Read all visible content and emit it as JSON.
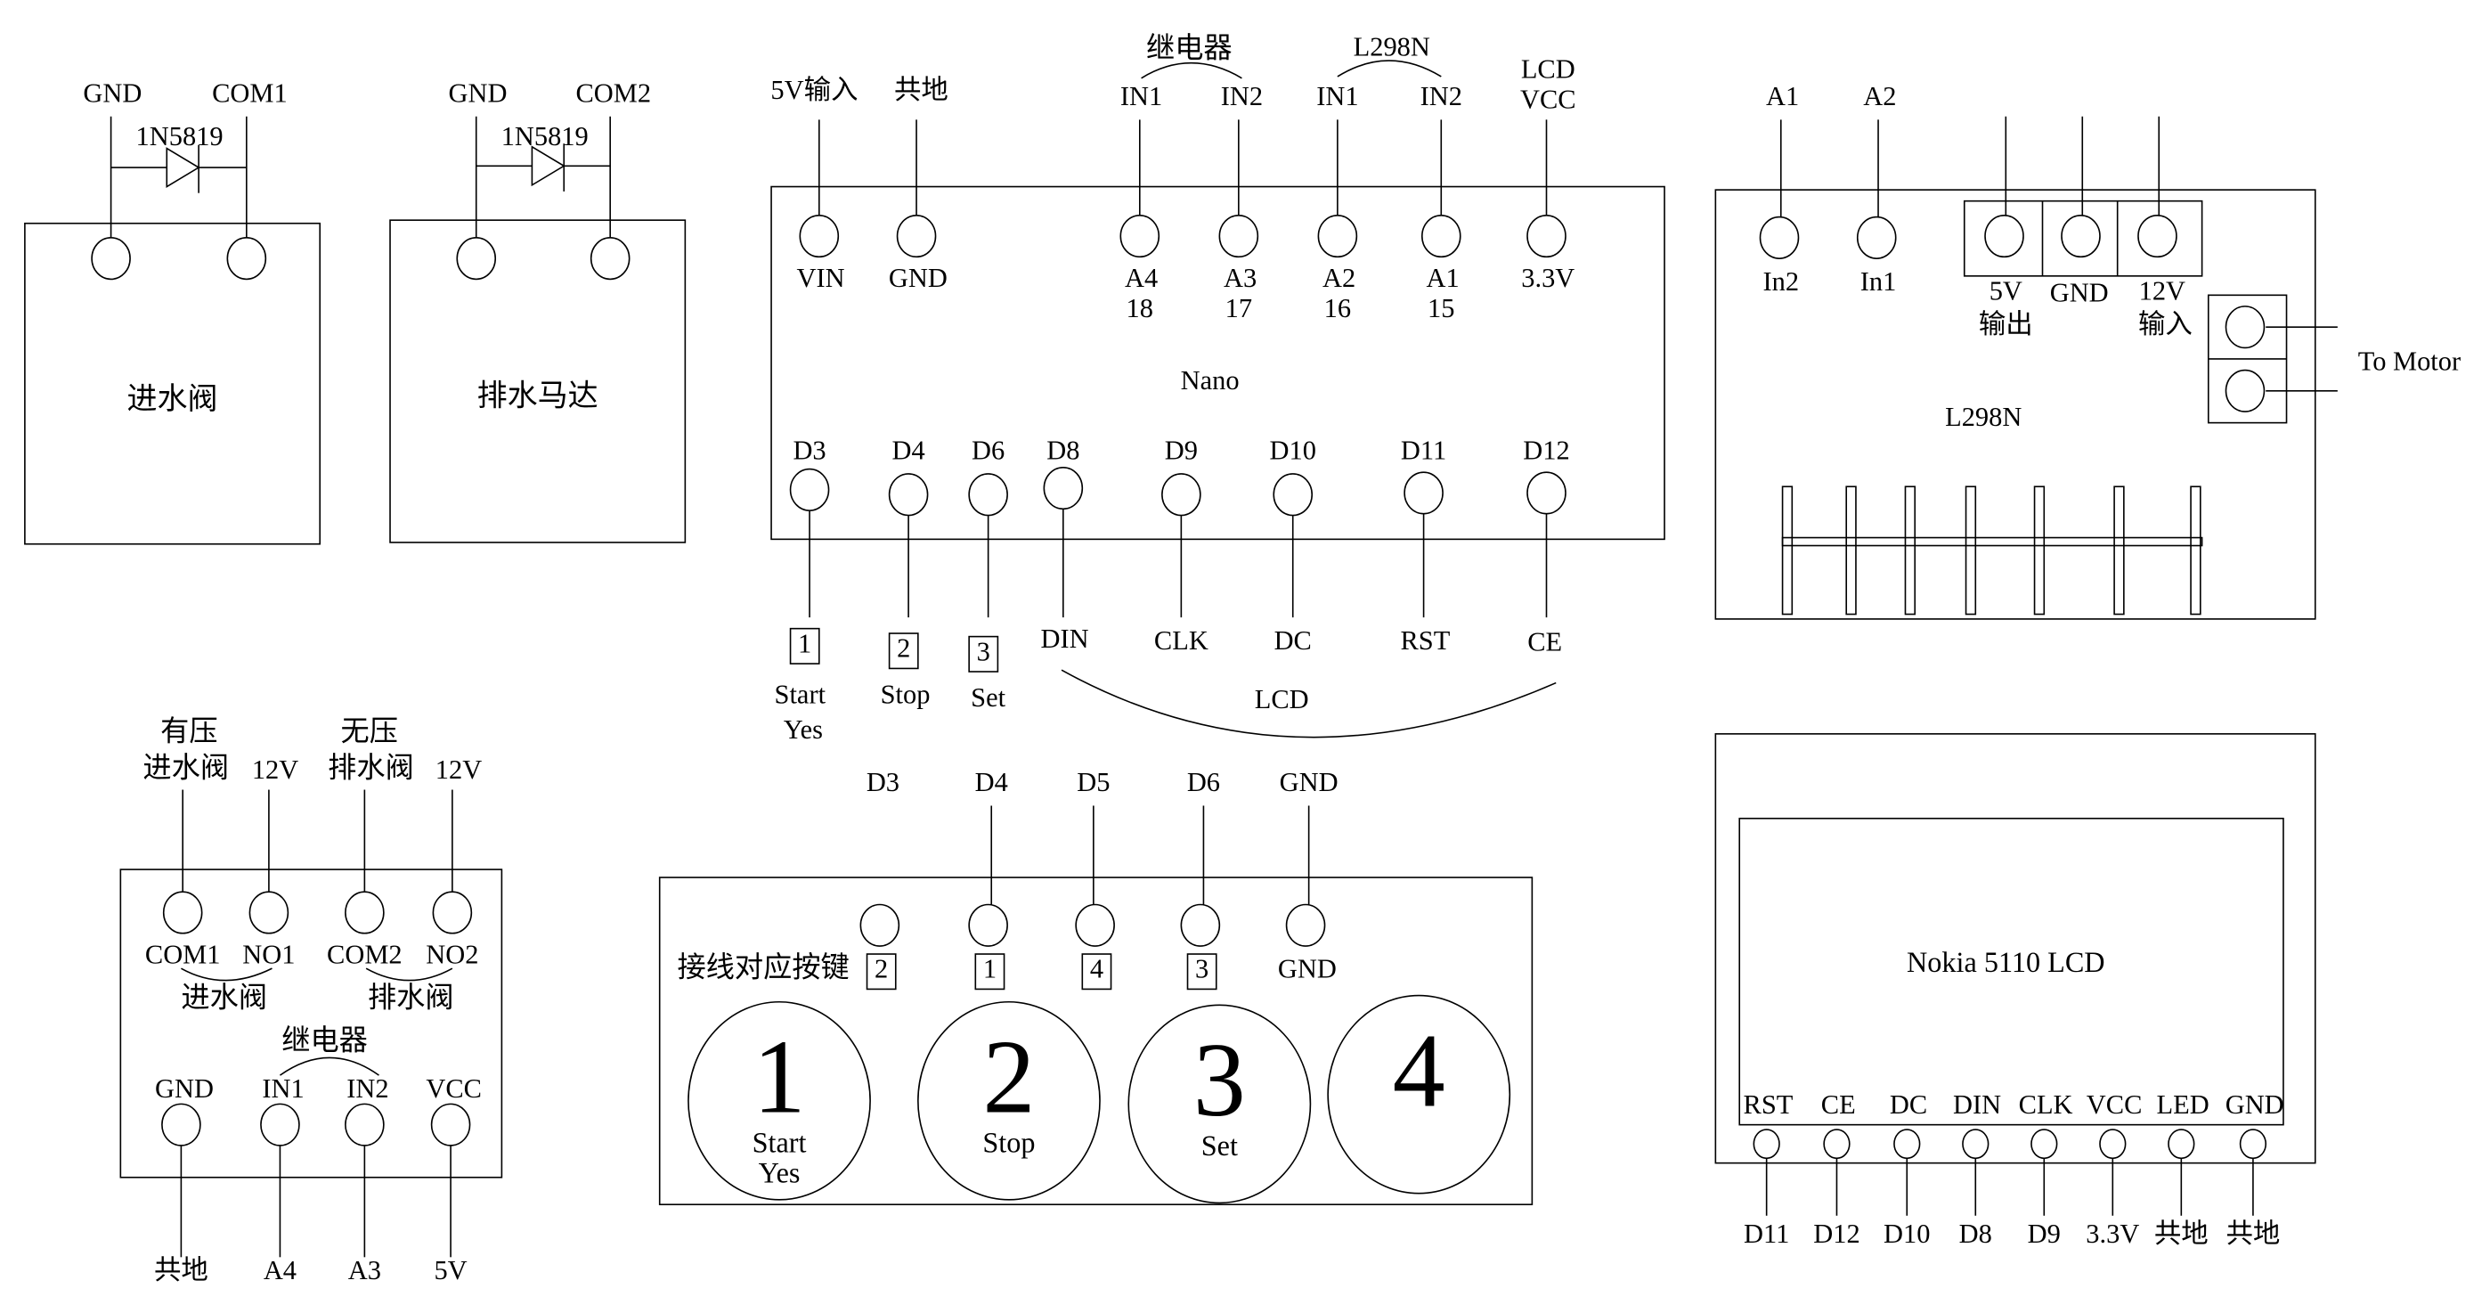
{
  "colors": {
    "line": "#000000",
    "background": "#ffffff"
  },
  "inlet_valve": {
    "title": "进水阀",
    "pins": [
      "GND",
      "COM1"
    ],
    "diode": "1N5819"
  },
  "drain_motor": {
    "title": "排水马达",
    "pins": [
      "GND",
      "COM2"
    ],
    "diode": "1N5819"
  },
  "nano": {
    "title": "Nano",
    "top_wires": {
      "vin": "5V输入",
      "gnd": "共地",
      "relay": "继电器",
      "relay_in1": "IN1",
      "relay_in2": "IN2",
      "l298n": "L298N",
      "l298n_in1": "IN1",
      "l298n_in2": "IN2",
      "lcd_vcc_1": "LCD",
      "lcd_vcc_2": "VCC"
    },
    "top_pins": [
      {
        "name": "VIN",
        "num": ""
      },
      {
        "name": "GND",
        "num": ""
      },
      {
        "name": "A4",
        "num": "18"
      },
      {
        "name": "A3",
        "num": "17"
      },
      {
        "name": "A2",
        "num": "16"
      },
      {
        "name": "A1",
        "num": "15"
      },
      {
        "name": "3.3V",
        "num": ""
      }
    ],
    "bottom_pins": [
      "D3",
      "D4",
      "D6",
      "D8",
      "D9",
      "D10",
      "D11",
      "D12"
    ],
    "bottom_targets": {
      "b1": "1",
      "b2": "2",
      "b3": "3",
      "din": "DIN",
      "clk": "CLK",
      "dc": "DC",
      "rst": "RST",
      "ce": "CE"
    },
    "button_names": {
      "start": "Start",
      "yes": "Yes",
      "stop": "Stop",
      "set": "Set"
    },
    "lcd_group": "LCD"
  },
  "l298n": {
    "title": "L298N",
    "wires": {
      "a1": "A1",
      "a2": "A2"
    },
    "pins": {
      "in2": "In2",
      "in1": "In1",
      "v5": "5V",
      "v5_sub": "输出",
      "gnd": "GND",
      "v12": "12V",
      "v12_sub": "输入"
    },
    "motor": "To Motor"
  },
  "relay": {
    "title": "继电器",
    "wires": {
      "pressured": "有压",
      "inlet_valve": "进水阀",
      "v12a": "12V",
      "unpressured": "无压",
      "drain_valve": "排水阀",
      "v12b": "12V"
    },
    "out_pins": [
      "COM1",
      "NO1",
      "COM2",
      "NO2"
    ],
    "out_groups": {
      "inlet": "进水阀",
      "drain": "排水阀"
    },
    "in_pins": [
      "GND",
      "IN1",
      "IN2",
      "VCC"
    ],
    "in_targets": [
      "共地",
      "A4",
      "A3",
      "5V"
    ]
  },
  "buttons": {
    "wires": [
      "D3",
      "D4",
      "D5",
      "D6",
      "GND"
    ],
    "map_label": "接线对应按键",
    "key_map": [
      "2",
      "1",
      "4",
      "3",
      "GND"
    ],
    "keys": [
      {
        "num": "1",
        "l1": "Start",
        "l2": "Yes"
      },
      {
        "num": "2",
        "l1": "Stop",
        "l2": ""
      },
      {
        "num": "3",
        "l1": "Set",
        "l2": ""
      },
      {
        "num": "4",
        "l1": "",
        "l2": ""
      }
    ]
  },
  "nokia": {
    "title": "Nokia 5110 LCD",
    "pins": [
      "RST",
      "CE",
      "DC",
      "DIN",
      "CLK",
      "VCC",
      "LED",
      "GND"
    ],
    "targets": [
      "D11",
      "D12",
      "D10",
      "D8",
      "D9",
      "3.3V",
      "共地",
      "共地"
    ]
  }
}
